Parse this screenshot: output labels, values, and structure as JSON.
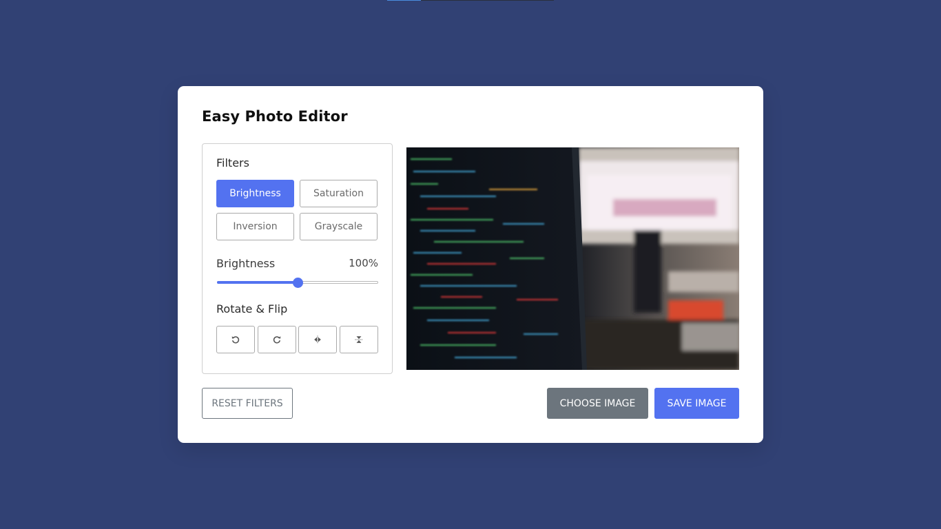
{
  "app": {
    "title": "Easy Photo Editor"
  },
  "filters": {
    "heading": "Filters",
    "buttons": [
      {
        "label": "Brightness",
        "active": true
      },
      {
        "label": "Saturation",
        "active": false
      },
      {
        "label": "Inversion",
        "active": false
      },
      {
        "label": "Grayscale",
        "active": false
      }
    ]
  },
  "slider": {
    "name": "Brightness",
    "value_text": "100%",
    "value": 100,
    "max": 200
  },
  "rotate": {
    "heading": "Rotate & Flip",
    "icons": [
      "rotate-left-icon",
      "rotate-right-icon",
      "flip-horizontal-icon",
      "flip-vertical-icon"
    ]
  },
  "preview": {
    "alt": "code-on-monitor-photo"
  },
  "actions": {
    "reset_label": "RESET FILTERS",
    "choose_label": "CHOOSE IMAGE",
    "save_label": "SAVE IMAGE"
  },
  "colors": {
    "background": "#314174",
    "accent": "#5372f0",
    "secondary": "#6c757d"
  }
}
